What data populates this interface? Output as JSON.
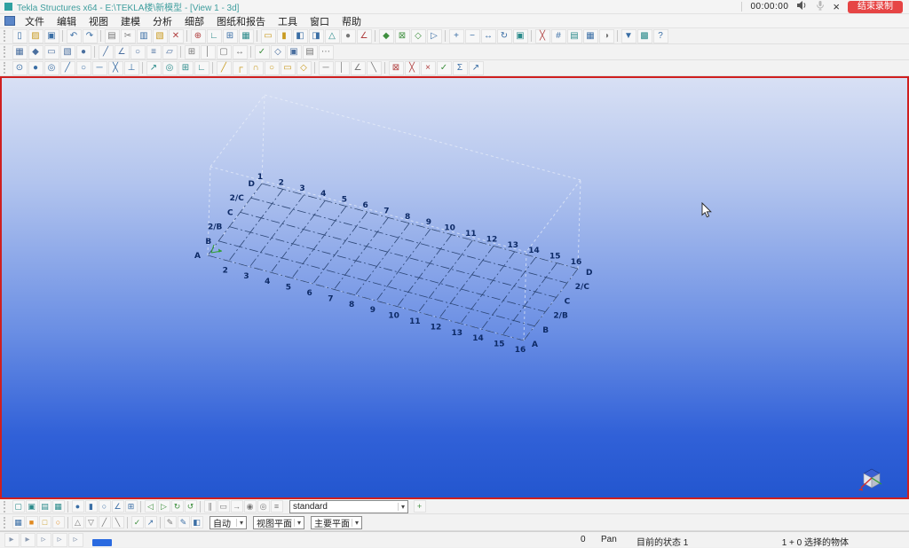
{
  "titlebar": {
    "title": "Tekla Structures x64 - E:\\TEKLA楼\\新模型 - [View 1 - 3d]",
    "timer": "00:00:00",
    "record_label": "结束录制"
  },
  "menubar": {
    "items": [
      "文件",
      "编辑",
      "视图",
      "建模",
      "分析",
      "细部",
      "图纸和报告",
      "工具",
      "窗口",
      "帮助"
    ]
  },
  "toolbars": {
    "row1": [
      {
        "n": "new-model",
        "g": "▯",
        "c": "#3a6ea5"
      },
      {
        "n": "open-model",
        "g": "▨",
        "c": "#c89a20"
      },
      {
        "n": "save-model",
        "g": "▣",
        "c": "#3a6ea5"
      },
      {
        "sep": true
      },
      {
        "n": "undo",
        "g": "↶",
        "c": "#3a6ea5"
      },
      {
        "n": "redo",
        "g": "↷",
        "c": "#3a6ea5"
      },
      {
        "sep": true
      },
      {
        "n": "print",
        "g": "▤",
        "c": "#777777"
      },
      {
        "n": "cut",
        "g": "✂",
        "c": "#777777"
      },
      {
        "n": "copy",
        "g": "▥",
        "c": "#3a6ea5"
      },
      {
        "n": "paste",
        "g": "▧",
        "c": "#c89a20"
      },
      {
        "n": "delete",
        "g": "✕",
        "c": "#b04040"
      },
      {
        "sep": true
      },
      {
        "n": "create-point",
        "g": "⊕",
        "c": "#b04040"
      },
      {
        "n": "measure",
        "g": "∟",
        "c": "#2a8a8a"
      },
      {
        "n": "create-grid",
        "g": "⊞",
        "c": "#3a6ea5"
      },
      {
        "n": "create-view",
        "g": "▦",
        "c": "#2a8a8a"
      },
      {
        "sep": true
      },
      {
        "n": "create-beam",
        "g": "▭",
        "c": "#c89a20"
      },
      {
        "n": "create-column",
        "g": "▮",
        "c": "#c89a20"
      },
      {
        "n": "create-plate",
        "g": "◧",
        "c": "#3a6ea5"
      },
      {
        "n": "create-slab",
        "g": "◨",
        "c": "#3a6ea5"
      },
      {
        "n": "create-item",
        "g": "△",
        "c": "#2a8a8a"
      },
      {
        "n": "create-bolt",
        "g": "●",
        "c": "#777777"
      },
      {
        "n": "create-weld",
        "g": "∠",
        "c": "#b04040"
      },
      {
        "sep": true
      },
      {
        "n": "component-catalog",
        "g": "◆",
        "c": "#3f8f3f"
      },
      {
        "n": "auto-connection",
        "g": "⊠",
        "c": "#3f8f3f"
      },
      {
        "n": "detail-tool",
        "g": "◇",
        "c": "#3f8f3f"
      },
      {
        "n": "macro",
        "g": "▷",
        "c": "#3a6ea5"
      },
      {
        "sep": true
      },
      {
        "n": "zoom-in",
        "g": "+",
        "c": "#3a6ea5"
      },
      {
        "n": "zoom-out",
        "g": "−",
        "c": "#3a6ea5"
      },
      {
        "n": "pan-tool",
        "g": "↔",
        "c": "#3a6ea5"
      },
      {
        "n": "rotate-view",
        "g": "↻",
        "c": "#3a6ea5"
      },
      {
        "n": "fit-work-area",
        "g": "▣",
        "c": "#2a8a8a"
      },
      {
        "sep": true
      },
      {
        "n": "clash-check",
        "g": "╳",
        "c": "#b04040"
      },
      {
        "n": "numbering",
        "g": "#",
        "c": "#3a6ea5"
      },
      {
        "n": "report",
        "g": "▤",
        "c": "#2a8a8a"
      },
      {
        "n": "drawing-list",
        "g": "▦",
        "c": "#3a6ea5"
      },
      {
        "n": "phase-manager",
        "g": "◑",
        "c": "#777777"
      },
      {
        "sep": true
      },
      {
        "n": "selection-filter",
        "g": "▼",
        "c": "#3a6ea5"
      },
      {
        "n": "snapshot",
        "g": "▩",
        "c": "#2a8a8a"
      },
      {
        "n": "help",
        "g": "?",
        "c": "#3a6ea5"
      }
    ],
    "row2": [
      {
        "n": "select-all-switch",
        "g": "▦",
        "c": "#4a6f9f"
      },
      {
        "n": "select-components",
        "g": "◆",
        "c": "#4a6f9f"
      },
      {
        "n": "select-parts",
        "g": "▭",
        "c": "#4a6f9f"
      },
      {
        "n": "select-surfaces",
        "g": "▧",
        "c": "#4a6f9f"
      },
      {
        "n": "select-points",
        "g": "●",
        "c": "#4a6f9f"
      },
      {
        "sep": true
      },
      {
        "n": "select-lines",
        "g": "╱",
        "c": "#4a6f9f"
      },
      {
        "n": "select-welds",
        "g": "∠",
        "c": "#4a6f9f"
      },
      {
        "n": "select-bolts",
        "g": "○",
        "c": "#4a6f9f"
      },
      {
        "n": "select-rebar",
        "g": "≡",
        "c": "#4a6f9f"
      },
      {
        "n": "select-planes",
        "g": "▱",
        "c": "#4a6f9f"
      },
      {
        "sep": true
      },
      {
        "n": "select-grids",
        "g": "⊞",
        "c": "#777777"
      },
      {
        "n": "select-grid-lines",
        "g": "│",
        "c": "#777777"
      },
      {
        "n": "select-views",
        "g": "▢",
        "c": "#777777"
      },
      {
        "n": "select-distances",
        "g": "↔",
        "c": "#777777"
      },
      {
        "sep": true
      },
      {
        "n": "select-marks",
        "g": "✓",
        "c": "#3f8f3f"
      },
      {
        "n": "select-objects",
        "g": "◇",
        "c": "#4a6f9f"
      },
      {
        "n": "select-assemblies",
        "g": "▣",
        "c": "#4a6f9f"
      },
      {
        "n": "select-tasks",
        "g": "▤",
        "c": "#777777"
      },
      {
        "n": "select-more",
        "g": "⋯",
        "c": "#777777"
      }
    ],
    "row3": [
      {
        "n": "snap-reference-points",
        "g": "⊙",
        "c": "#3a6ea5"
      },
      {
        "n": "snap-geometry-points",
        "g": "●",
        "c": "#3a6ea5"
      },
      {
        "n": "snap-nearest-point",
        "g": "◎",
        "c": "#3a6ea5"
      },
      {
        "n": "snap-end-points",
        "g": "╱",
        "c": "#3a6ea5"
      },
      {
        "n": "snap-center-points",
        "g": "○",
        "c": "#3a6ea5"
      },
      {
        "n": "snap-midpoints",
        "g": "─",
        "c": "#3a6ea5"
      },
      {
        "n": "snap-intersections",
        "g": "╳",
        "c": "#3a6ea5"
      },
      {
        "n": "snap-perpendicular",
        "g": "⊥",
        "c": "#3a6ea5"
      },
      {
        "sep": true
      },
      {
        "n": "snap-extension",
        "g": "↗",
        "c": "#2a8a8a"
      },
      {
        "n": "snap-any-position",
        "g": "◎",
        "c": "#2a8a8a"
      },
      {
        "n": "snap-grid-points",
        "g": "⊞",
        "c": "#2a8a8a"
      },
      {
        "n": "ortho-toggle",
        "g": "∟",
        "c": "#2a8a8a"
      },
      {
        "sep": true
      },
      {
        "n": "create-line",
        "g": "╱",
        "c": "#c89a20"
      },
      {
        "n": "create-polyline",
        "g": "┌",
        "c": "#c89a20"
      },
      {
        "n": "create-arc",
        "g": "∩",
        "c": "#c89a20"
      },
      {
        "n": "create-circle",
        "g": "○",
        "c": "#c89a20"
      },
      {
        "n": "create-rectangle",
        "g": "▭",
        "c": "#c89a20"
      },
      {
        "n": "create-polygon",
        "g": "◇",
        "c": "#c89a20"
      },
      {
        "sep": true
      },
      {
        "n": "measure-x",
        "g": "─",
        "c": "#777777"
      },
      {
        "n": "measure-y",
        "g": "│",
        "c": "#777777"
      },
      {
        "n": "measure-angle",
        "g": "∠",
        "c": "#777777"
      },
      {
        "n": "measure-free",
        "g": "╲",
        "c": "#777777"
      },
      {
        "sep": true
      },
      {
        "n": "delete-point",
        "g": "⊠",
        "c": "#b04040"
      },
      {
        "n": "delete-line",
        "g": "╳",
        "c": "#b04040"
      },
      {
        "n": "delete-all",
        "g": "×",
        "c": "#b04040"
      },
      {
        "n": "verify",
        "g": "✓",
        "c": "#3f8f3f"
      },
      {
        "n": "sum-tool",
        "g": "Σ",
        "c": "#3a6ea5"
      },
      {
        "n": "pointer-tool",
        "g": "↗",
        "c": "#3a6ea5"
      }
    ]
  },
  "viewport": {
    "grid": {
      "numbers": [
        "1",
        "2",
        "3",
        "4",
        "5",
        "6",
        "7",
        "8",
        "9",
        "10",
        "11",
        "12",
        "13",
        "14",
        "15",
        "16"
      ],
      "letters": [
        "D",
        "2/C",
        "C",
        "2/B",
        "B",
        "A"
      ]
    }
  },
  "bottom": {
    "row1": [
      {
        "n": "view-wireframe",
        "g": "▢",
        "c": "#2a8a8a"
      },
      {
        "n": "view-shaded",
        "g": "▣",
        "c": "#2a8a8a"
      },
      {
        "n": "view-hidden-lines",
        "g": "▤",
        "c": "#2a8a8a"
      },
      {
        "n": "view-rendered",
        "g": "▦",
        "c": "#2a8a8a"
      },
      {
        "sep": true
      },
      {
        "n": "toggle-points",
        "g": "●",
        "c": "#3a6ea5"
      },
      {
        "n": "toggle-parts",
        "g": "▮",
        "c": "#3a6ea5"
      },
      {
        "n": "toggle-bolts",
        "g": "○",
        "c": "#3a6ea5"
      },
      {
        "n": "toggle-welds",
        "g": "∠",
        "c": "#3a6ea5"
      },
      {
        "n": "toggle-grids",
        "g": "⊞",
        "c": "#3a6ea5"
      },
      {
        "sep": true
      },
      {
        "n": "view-previous",
        "g": "◁",
        "c": "#3f8f3f"
      },
      {
        "n": "view-next",
        "g": "▷",
        "c": "#3f8f3f"
      },
      {
        "n": "redraw-view",
        "g": "↻",
        "c": "#3f8f3f"
      },
      {
        "n": "update-window",
        "g": "↺",
        "c": "#3f8f3f"
      },
      {
        "sep": true
      },
      {
        "n": "clip-plane",
        "g": "∥",
        "c": "#777777"
      },
      {
        "n": "work-area",
        "g": "▭",
        "c": "#777777"
      },
      {
        "n": "flight-mode",
        "g": "→",
        "c": "#777777"
      },
      {
        "n": "screenshot",
        "g": "◉",
        "c": "#777777"
      },
      {
        "n": "visibility-settings",
        "g": "◎",
        "c": "#777777"
      },
      {
        "n": "display-settings",
        "g": "≡",
        "c": "#777777"
      }
    ],
    "row1_end": [
      {
        "n": "apply-filter",
        "g": "+",
        "c": "#3f8f3f"
      }
    ],
    "phase": {
      "value": "standard"
    },
    "row2": [
      {
        "n": "select-switch",
        "g": "▦",
        "c": "#3a6ea5"
      },
      {
        "n": "phase-colors",
        "g": "■",
        "c": "#e08a20"
      },
      {
        "n": "class-colors",
        "g": "□",
        "c": "#c89a20"
      },
      {
        "n": "lot-colors",
        "g": "○",
        "c": "#e08a20"
      },
      {
        "sep": true
      },
      {
        "n": "tri-up-tool",
        "g": "△",
        "c": "#777777"
      },
      {
        "n": "tri-down-tool",
        "g": "▽",
        "c": "#777777"
      },
      {
        "n": "line-tool-a",
        "g": "╱",
        "c": "#777777"
      },
      {
        "n": "line-tool-b",
        "g": "╲",
        "c": "#777777"
      },
      {
        "sep": true
      },
      {
        "n": "confirm-tool",
        "g": "✓",
        "c": "#3f8f3f"
      },
      {
        "n": "direction-tool",
        "g": "↗",
        "c": "#3a6ea5"
      },
      {
        "sep": true
      },
      {
        "n": "edit-sketch",
        "g": "✎",
        "c": "#777777"
      },
      {
        "n": "edit-profile",
        "g": "✎",
        "c": "#3a6ea5"
      },
      {
        "n": "paint-tool",
        "g": "◧",
        "c": "#3a6ea5"
      }
    ],
    "snap_dropdowns": [
      {
        "name": "snap-mode",
        "value": "自动"
      },
      {
        "name": "plane-mode",
        "value": "视图平面"
      },
      {
        "name": "plane-type",
        "value": "主要平面"
      }
    ]
  },
  "statusbar": {
    "icons": [
      {
        "n": "status-flag-1",
        "g": "▸",
        "c": "#8a9ab0"
      },
      {
        "n": "status-flag-2",
        "g": "▸",
        "c": "#8a9ab0"
      },
      {
        "n": "status-flag-3",
        "g": "▹",
        "c": "#8a9ab0"
      },
      {
        "n": "status-flag-4",
        "g": "▹",
        "c": "#8a9ab0"
      },
      {
        "n": "status-flag-5",
        "g": "▹",
        "c": "#8a9ab0"
      }
    ],
    "left_value": "0",
    "mode": "Pan",
    "status": "目前的状态 1",
    "selection": "1 + 0 选择的物体"
  }
}
